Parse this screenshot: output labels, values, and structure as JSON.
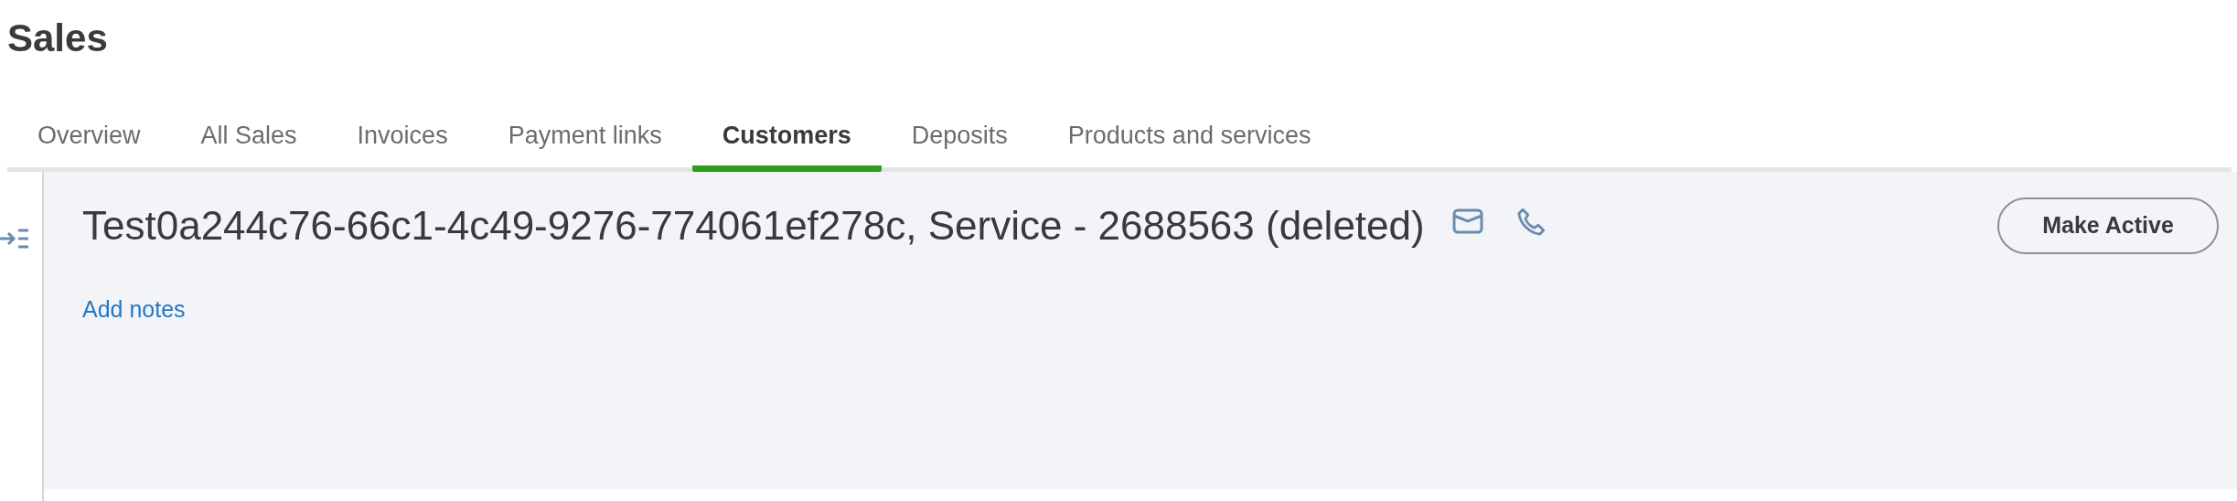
{
  "page_title": "Sales",
  "tabs": [
    {
      "label": "Overview",
      "selected": false
    },
    {
      "label": "All Sales",
      "selected": false
    },
    {
      "label": "Invoices",
      "selected": false
    },
    {
      "label": "Payment links",
      "selected": false
    },
    {
      "label": "Customers",
      "selected": true
    },
    {
      "label": "Deposits",
      "selected": false
    },
    {
      "label": "Products and services",
      "selected": false
    }
  ],
  "customer": {
    "name": "Test0a244c76-66c1-4c49-9276-774061ef278c, Service - 2688563 (deleted)",
    "add_notes_link": "Add notes",
    "action_button": "Make Active"
  }
}
